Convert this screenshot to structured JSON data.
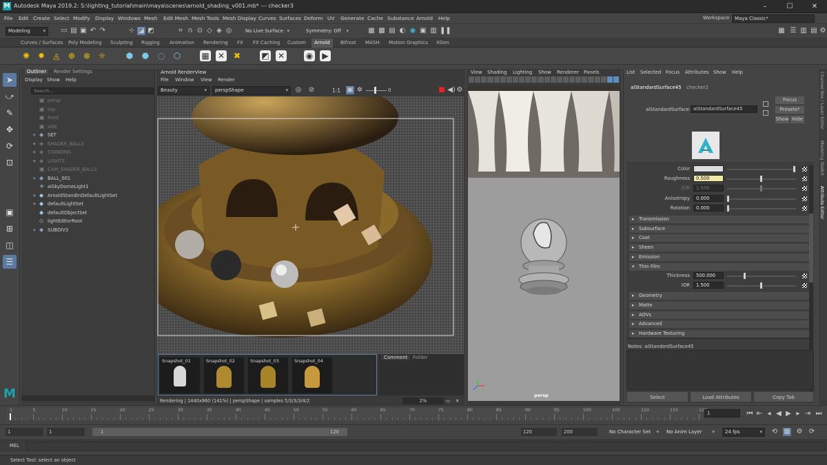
{
  "window": {
    "title": "Autodesk Maya 2019.2: S:\\lighting_tutorial\\main\\maya\\scenes\\arnold_shading_v001.mb*  ---  checker3",
    "logo": "M"
  },
  "menus": [
    "File",
    "Edit",
    "Create",
    "Select",
    "Modify",
    "Display",
    "Windows",
    "Mesh",
    "Edit Mesh",
    "Mesh Tools",
    "Mesh Display",
    "Curves",
    "Surfaces",
    "Deform",
    "UV",
    "Generate",
    "Cache",
    "Substance",
    "Arnold",
    "Help"
  ],
  "workspace": {
    "label": "Workspace :",
    "value": "Maya Classic*"
  },
  "statusline": {
    "mode": "Modeling",
    "live_surface": "No Live Surface",
    "symmetry": "Symmetry: Off"
  },
  "shelf_tabs": [
    "Curves / Surfaces",
    "Poly Modeling",
    "Sculpting",
    "Rigging",
    "Animation",
    "Rendering",
    "FX",
    "FX Caching",
    "Custom",
    "Arnold",
    "Bifrost",
    "MASH",
    "Motion Graphics",
    "XGen"
  ],
  "shelf_active": "Arnold",
  "outliner": {
    "tabs": [
      "Outliner",
      "Render Settings"
    ],
    "menus": [
      "Display",
      "Show",
      "Help"
    ],
    "search_placeholder": "Search...",
    "items": [
      {
        "label": "persp",
        "dim": true,
        "exp": ""
      },
      {
        "label": "top",
        "dim": true,
        "exp": ""
      },
      {
        "label": "front",
        "dim": true,
        "exp": ""
      },
      {
        "label": "side",
        "dim": true,
        "exp": ""
      },
      {
        "label": "SET",
        "dim": false,
        "exp": "+"
      },
      {
        "label": "SHADER_BALLS",
        "dim": true,
        "exp": "+"
      },
      {
        "label": "STANDINS",
        "dim": true,
        "exp": "+"
      },
      {
        "label": "LIGHTS",
        "dim": true,
        "exp": "+"
      },
      {
        "label": "CAM_SHADER_BALLS",
        "dim": true,
        "exp": ""
      },
      {
        "label": "BALL_001",
        "dim": false,
        "exp": "+"
      },
      {
        "label": "aiSkyDomeLight1",
        "dim": false,
        "exp": ""
      },
      {
        "label": "ArnoldStandInDefaultLightSet",
        "dim": false,
        "exp": "+"
      },
      {
        "label": "defaultLightSet",
        "dim": false,
        "exp": "+"
      },
      {
        "label": "defaultObjectSet",
        "dim": false,
        "exp": ""
      },
      {
        "label": "lightEditorRoot",
        "dim": false,
        "exp": ""
      },
      {
        "label": "SUBDIV3",
        "dim": false,
        "exp": "+"
      }
    ]
  },
  "renderview": {
    "title": "Arnold RenderView",
    "menus": [
      "File",
      "Window",
      "View",
      "Render"
    ],
    "aov": "Beauty",
    "camera": "perspShape",
    "ratio": "1:1",
    "exposure": "0",
    "snapshots": [
      "Snapshot_01",
      "Snapshot_02",
      "Snapshot_03",
      "Snapshot_04"
    ],
    "comment_tabs": [
      "Comment",
      "Folder"
    ],
    "status": "Rendering | 1440x960 (141%) | perspShape  |  samples 5/3/3/3/4/2",
    "zoom": "2%"
  },
  "viewport": {
    "menus": [
      "View",
      "Shading",
      "Lighting",
      "Show",
      "Renderer",
      "Panels"
    ],
    "camera_label": "persp"
  },
  "attribute_editor": {
    "menus": [
      "List",
      "Selected",
      "Focus",
      "Attributes",
      "Show",
      "Help"
    ],
    "tabs": [
      "aiStandardSurface45",
      "checker2"
    ],
    "node_type_label": "aiStandardSurface:",
    "node_name": "aiStandardSurface45",
    "buttons": {
      "focus": "Focus",
      "presets": "Presets*",
      "show": "Show",
      "hide": "Hide"
    },
    "attrs": [
      {
        "label": "Color",
        "value": "",
        "pct": 1.0
      },
      {
        "label": "Roughness",
        "value": "0.500",
        "pct": 0.5
      },
      {
        "label": "IOR",
        "value": "1.500",
        "pct": 0.5
      },
      {
        "label": "Anisotropy",
        "value": "0.000",
        "pct": 0.0
      },
      {
        "label": "Rotation",
        "value": "0.000",
        "pct": 0.0
      }
    ],
    "sections": [
      "Transmission",
      "Subsurface",
      "Coat",
      "Sheen",
      "Emission",
      "Thin Film",
      "Geometry",
      "Matte",
      "AOVs",
      "Advanced",
      "Hardware Texturing"
    ],
    "thin_film": [
      {
        "label": "Thickness",
        "value": "500.000",
        "pct": 0.25
      },
      {
        "label": "IOR",
        "value": "1.500",
        "pct": 0.5
      }
    ],
    "notes_label": "Notes:  aiStandardSurface45",
    "bottom_buttons": [
      "Select",
      "Load Attributes",
      "Copy Tab"
    ]
  },
  "side_tabs": [
    "Channel Box / Layer Editor",
    "Modeling Toolkit",
    "Attribute Editor"
  ],
  "timeline": {
    "ticks": [
      "1",
      "5",
      "10",
      "15",
      "20",
      "25",
      "30",
      "35",
      "40",
      "45",
      "50",
      "55",
      "60",
      "65",
      "70",
      "75",
      "80",
      "85",
      "90",
      "95",
      "100",
      "105",
      "110",
      "115",
      "120"
    ],
    "current_frame": "1"
  },
  "range": {
    "start": "1",
    "anim_start": "1",
    "slider_start": "1",
    "slider_end": "120",
    "anim_end": "120",
    "end": "200",
    "character_set": "No Character Set",
    "anim_layer": "No Anim Layer",
    "fps": "24 fps"
  },
  "mel": {
    "label": "MEL"
  },
  "help_line": "Select Tool: select an object"
}
